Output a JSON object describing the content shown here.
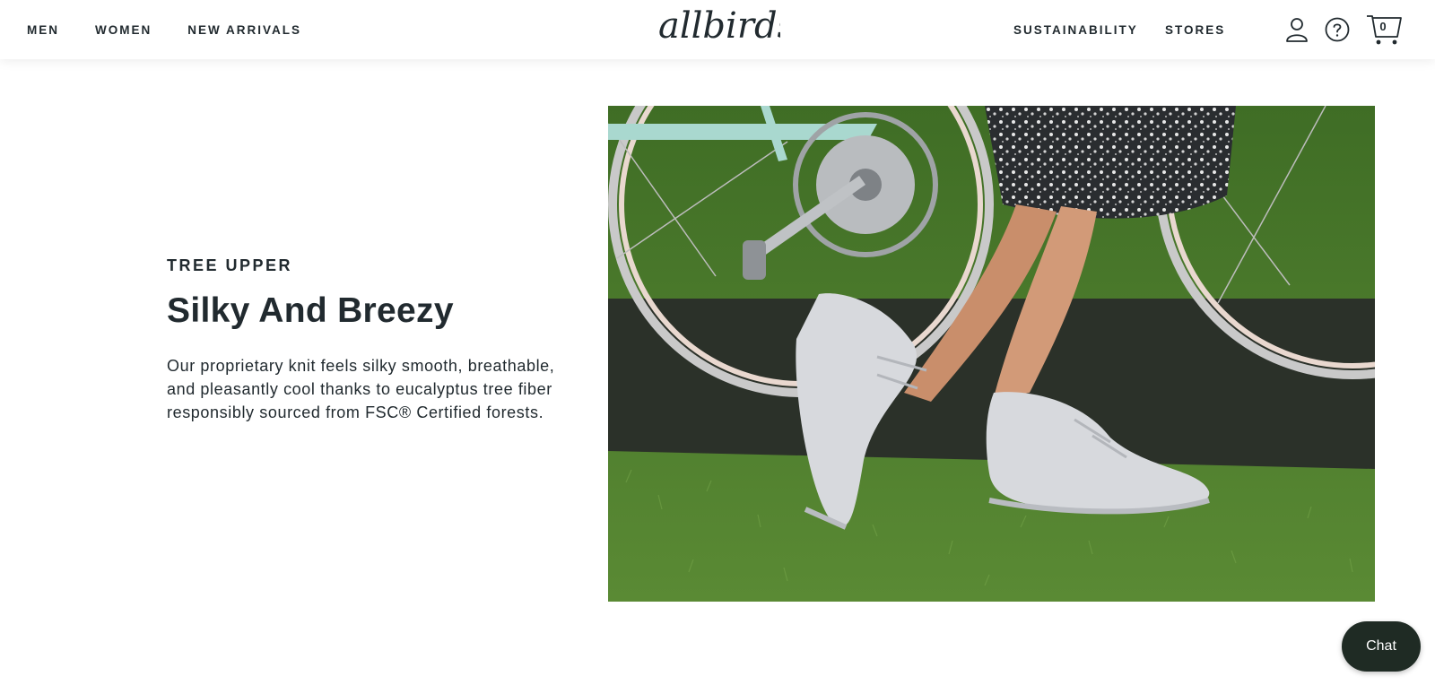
{
  "header": {
    "nav_left": [
      "MEN",
      "WOMEN",
      "NEW ARRIVALS"
    ],
    "logo_text": "allbirds",
    "nav_right": {
      "sustainability": "SUSTAINABILITY",
      "stores": "STORES"
    },
    "cart_count": "0"
  },
  "feature": {
    "eyebrow": "TREE UPPER",
    "headline": "Silky And Breezy",
    "body": "Our proprietary knit feels silky smooth, breathable, and pleasantly cool thanks to eucalyptus tree fiber responsibly sourced from FSC® Certified forests."
  },
  "chat": {
    "label": "Chat"
  },
  "colors": {
    "text": "#212a2f",
    "chat_bg": "#1f2b24",
    "grass": "#4a7a2c",
    "mat": "#2b3129",
    "bike_frame": "#a9d8cf",
    "shoe": "#d7d9dd"
  }
}
